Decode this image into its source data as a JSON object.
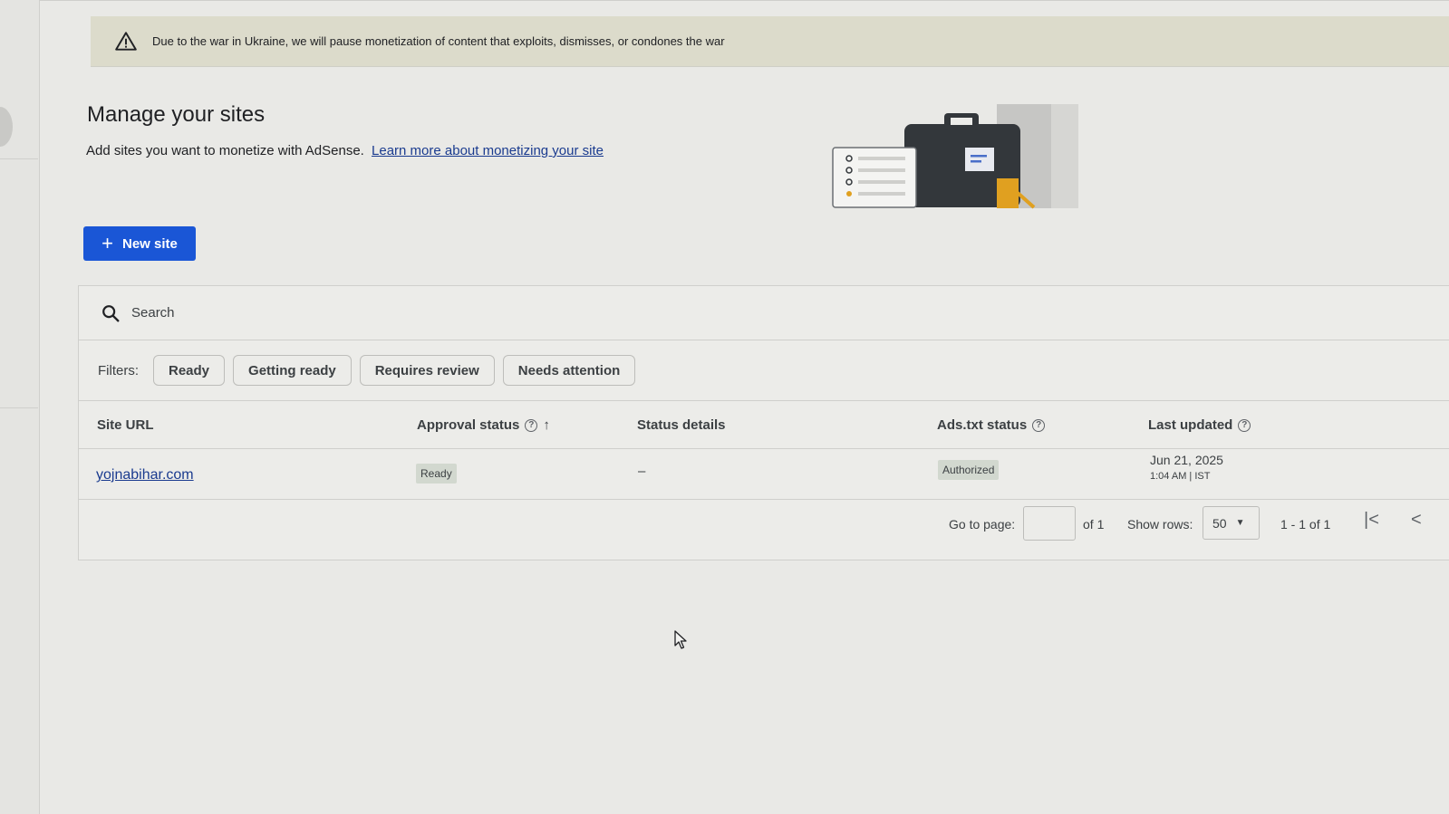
{
  "banner": {
    "icon": "warning-icon",
    "text": "Due to the war in Ukraine, we will pause monetization of content that exploits, dismisses, or condones the war"
  },
  "header": {
    "title": "Manage your sites",
    "subtitle": "Add sites you want to monetize with AdSense.",
    "learn_more_link": "Learn more about monetizing your site"
  },
  "new_site_button": {
    "label": "New site",
    "color": "#1a56d6"
  },
  "search": {
    "placeholder": "Search"
  },
  "filters": {
    "label": "Filters:",
    "chips": [
      "Ready",
      "Getting ready",
      "Requires review",
      "Needs attention"
    ]
  },
  "table": {
    "columns": {
      "site_url": "Site URL",
      "approval_status": "Approval status",
      "status_details": "Status details",
      "ads_txt_status": "Ads.txt status",
      "last_updated": "Last updated"
    },
    "rows": [
      {
        "site_url": "yojnabihar.com",
        "approval_status": "Ready",
        "status_details": "–",
        "ads_txt_status": "Authorized",
        "last_updated_date": "Jun 21, 2025",
        "last_updated_time": "1:04 AM | IST"
      }
    ]
  },
  "pagination": {
    "go_to_page_label": "Go to page:",
    "page_value": "",
    "of_pages": "of 1",
    "show_rows_label": "Show rows:",
    "rows_value": "50",
    "range": "1 - 1 of 1"
  }
}
